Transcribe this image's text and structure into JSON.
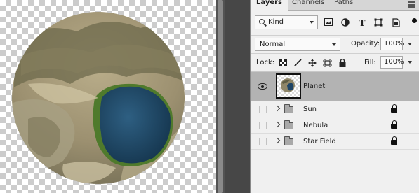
{
  "panel_tabs": [
    {
      "label": "Layers",
      "active": true
    },
    {
      "label": "Channels",
      "active": false
    },
    {
      "label": "Paths",
      "active": false
    }
  ],
  "filter": {
    "kind_label": "Kind",
    "icons": [
      "image-filter-icon",
      "adjustment-filter-icon",
      "type-filter-icon",
      "shape-filter-icon",
      "smart-object-filter-icon"
    ]
  },
  "blend": {
    "mode": "Normal",
    "opacity_label": "Opacity:",
    "opacity_value": "100%"
  },
  "lock": {
    "label": "Lock:",
    "icons": [
      "lock-transparent-icon",
      "lock-pixels-icon",
      "lock-position-icon",
      "lock-artboard-icon",
      "lock-all-icon"
    ],
    "fill_label": "Fill:",
    "fill_value": "100%"
  },
  "layers": [
    {
      "name": "Planet",
      "type": "layer",
      "visible": true,
      "selected": true,
      "locked": false
    },
    {
      "name": "Sun",
      "type": "group",
      "visible": false,
      "selected": false,
      "locked": true
    },
    {
      "name": "Nebula",
      "type": "group",
      "visible": false,
      "selected": false,
      "locked": true
    },
    {
      "name": "Star Field",
      "type": "group",
      "visible": false,
      "selected": false,
      "locked": true
    }
  ],
  "colors": {
    "canvas_checker_dark": "#cccccc",
    "panel_bg": "#f0f0f0",
    "selected_row": "#b3b3b3",
    "planet_water": "#1f4566",
    "planet_land": "#9a8f6e"
  }
}
